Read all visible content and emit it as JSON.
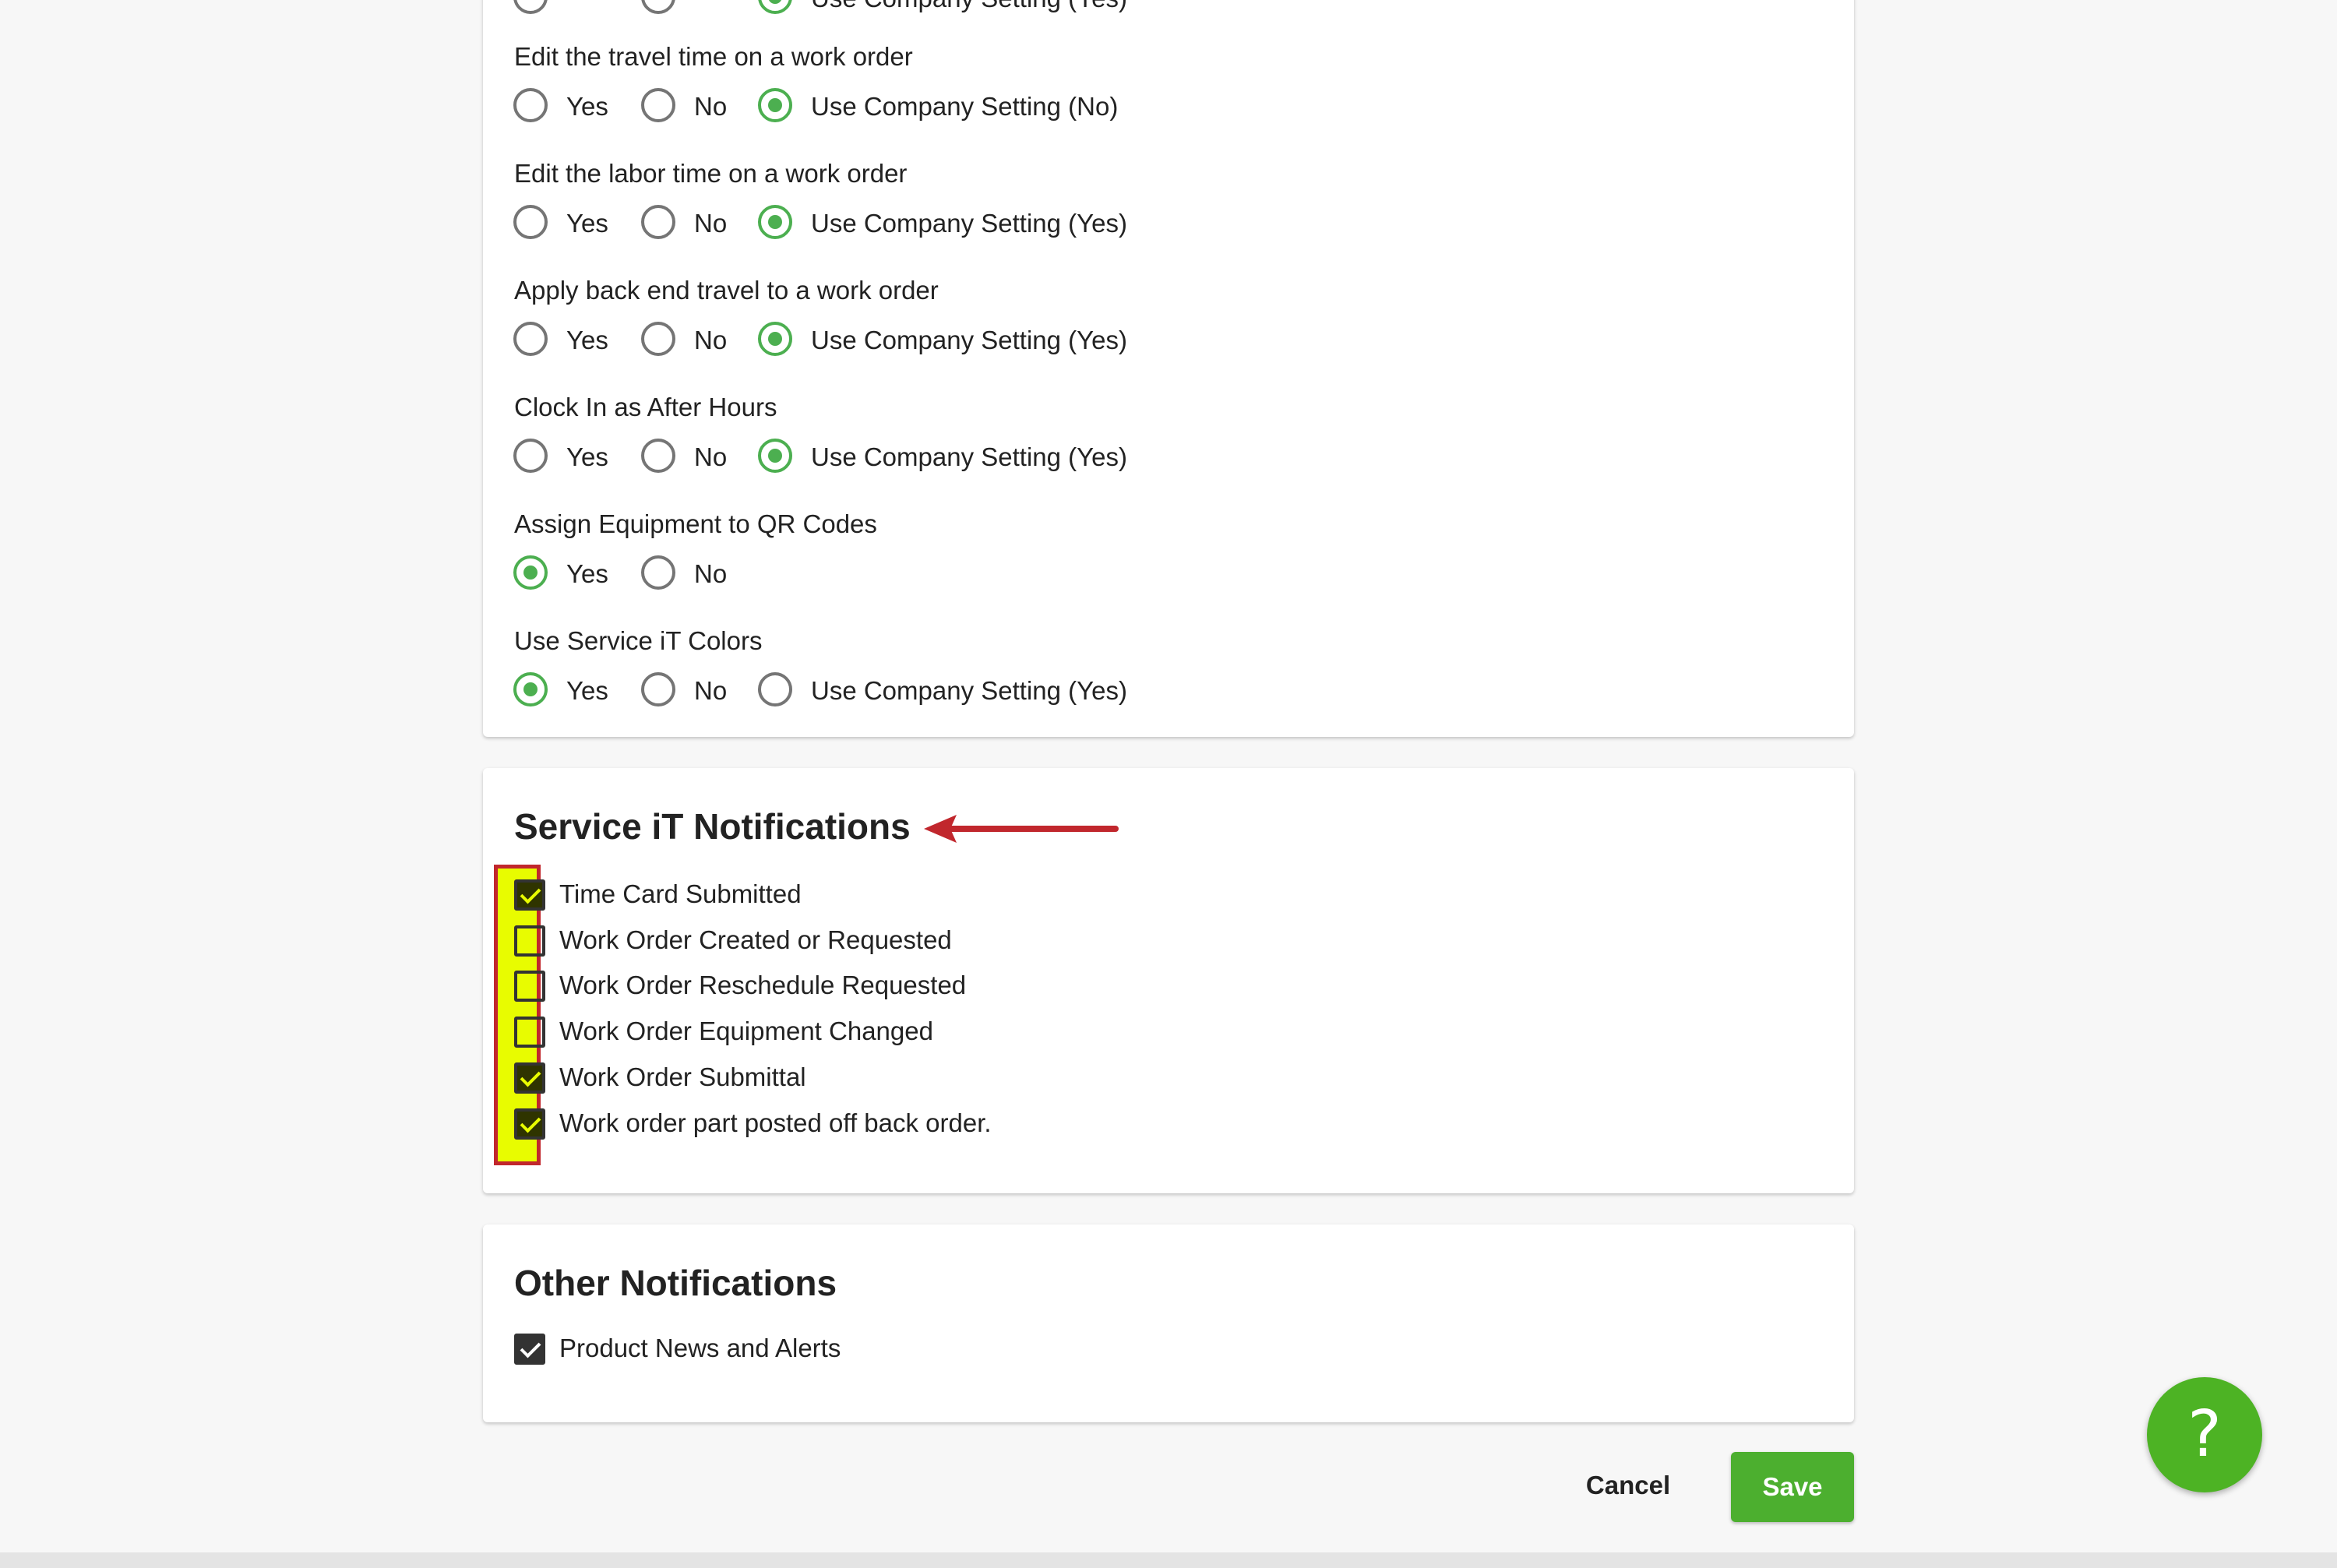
{
  "colors": {
    "accent": "#4caf50",
    "save_button": "#4caf2f",
    "help_button": "#4db324",
    "highlight_fill": "#e8fc00",
    "highlight_border": "#c1272d",
    "annotation_arrow": "#c1272d"
  },
  "settings": {
    "partial_top_option": "Use Company Setting (Yes)",
    "rows": [
      {
        "label": "Edit the travel time on a work order",
        "options": [
          "Yes",
          "No",
          "Use Company Setting (No)"
        ],
        "selected": "Use Company Setting (No)"
      },
      {
        "label": "Edit the labor time on a work order",
        "options": [
          "Yes",
          "No",
          "Use Company Setting (Yes)"
        ],
        "selected": "Use Company Setting (Yes)"
      },
      {
        "label": "Apply back end travel to a work order",
        "options": [
          "Yes",
          "No",
          "Use Company Setting (Yes)"
        ],
        "selected": "Use Company Setting (Yes)"
      },
      {
        "label": "Clock In as After Hours",
        "options": [
          "Yes",
          "No",
          "Use Company Setting (Yes)"
        ],
        "selected": "Use Company Setting (Yes)"
      },
      {
        "label": "Assign Equipment to QR Codes",
        "options": [
          "Yes",
          "No"
        ],
        "selected": "Yes"
      },
      {
        "label": "Use Service iT Colors",
        "options": [
          "Yes",
          "No",
          "Use Company Setting (Yes)"
        ],
        "selected": "Yes"
      }
    ]
  },
  "service_notifications": {
    "title": "Service iT Notifications",
    "items": [
      {
        "label": "Time Card Submitted",
        "checked": true
      },
      {
        "label": "Work Order Created or Requested",
        "checked": false
      },
      {
        "label": "Work Order Reschedule Requested",
        "checked": false
      },
      {
        "label": "Work Order Equipment Changed",
        "checked": false
      },
      {
        "label": "Work Order Submittal",
        "checked": true
      },
      {
        "label": "Work order part posted off back order.",
        "checked": true
      }
    ]
  },
  "other_notifications": {
    "title": "Other Notifications",
    "items": [
      {
        "label": "Product News and Alerts",
        "checked": true
      }
    ]
  },
  "actions": {
    "cancel_label": "Cancel",
    "save_label": "Save"
  },
  "help": {
    "icon": "question-mark-icon",
    "glyph": "?"
  }
}
